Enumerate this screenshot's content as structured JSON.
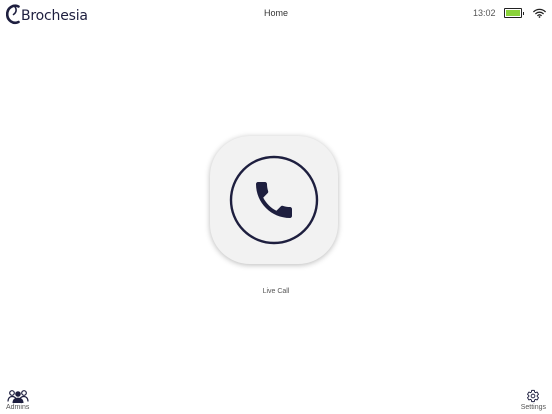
{
  "header": {
    "brand": "Brochesia",
    "title": "Home",
    "time": "13:02",
    "battery_level": 1.0,
    "battery_color": "#8ad33a"
  },
  "main": {
    "call_button_label": "Live Call",
    "call_icon": "phone-icon",
    "accent_color": "#1e1f3f"
  },
  "bottom_nav": {
    "admins_label": "Admins",
    "admins_icon": "users-icon",
    "settings_label": "Settings",
    "settings_icon": "gear-icon"
  }
}
